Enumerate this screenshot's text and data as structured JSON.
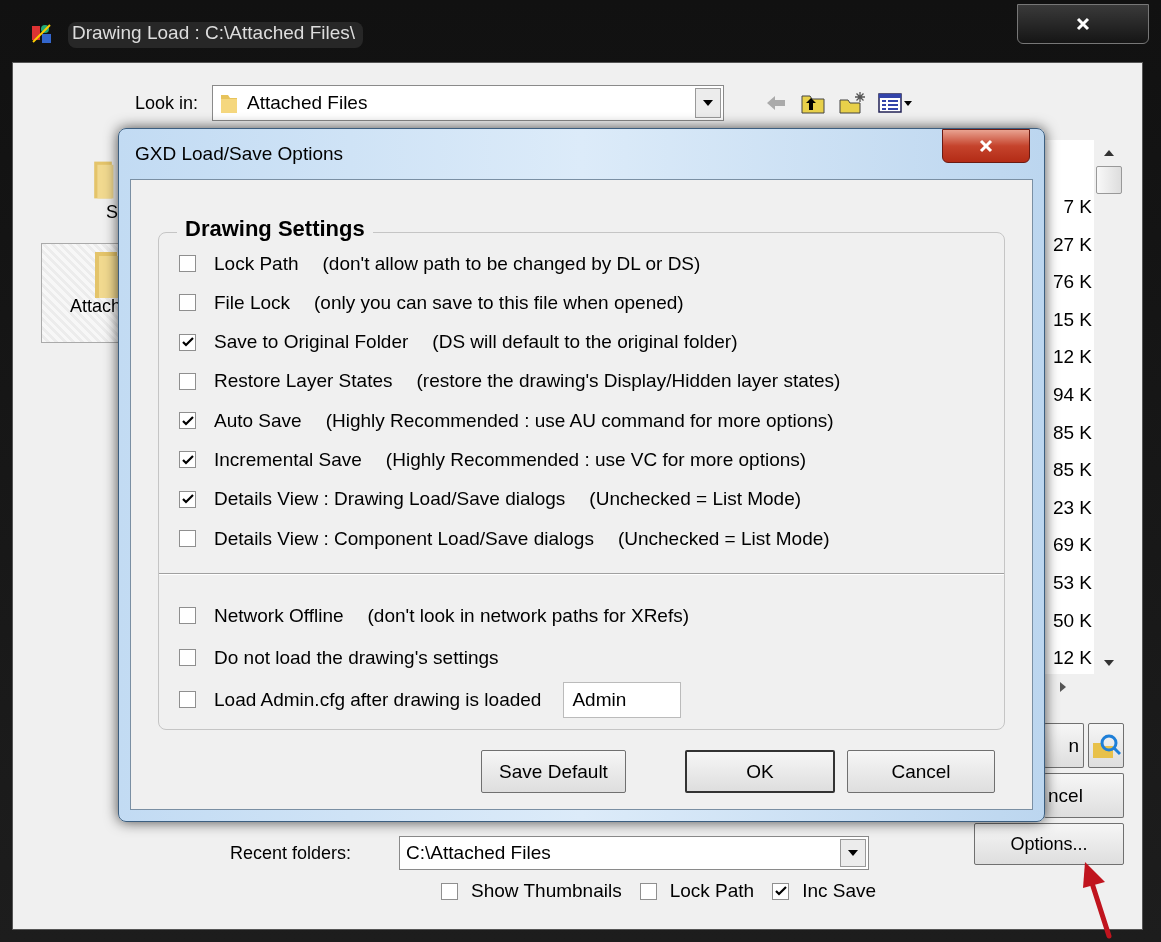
{
  "window": {
    "title": "Drawing Load : C:\\Attached Files\\"
  },
  "look_in": {
    "label": "Look in:",
    "value": "Attached Files"
  },
  "places": [
    {
      "label": "S",
      "selected": false
    },
    {
      "label": "Attach",
      "selected": true
    }
  ],
  "file_sizes": [
    "7 K",
    "27 K",
    "76 K",
    "15 K",
    "12 K",
    "94 K",
    "85 K",
    "85 K",
    "23 K",
    "69 K",
    "53 K",
    "50 K",
    "12 K"
  ],
  "side_buttons": [
    {
      "label": "n"
    },
    {
      "label": "ncel"
    },
    {
      "label": "Options..."
    }
  ],
  "recent_folders": {
    "label": "Recent folders:",
    "value": "C:\\Attached Files"
  },
  "bottom_options": [
    {
      "label": "Show Thumbnails",
      "checked": false
    },
    {
      "label": "Lock Path",
      "checked": false
    },
    {
      "label": "Inc Save",
      "checked": true
    }
  ],
  "dialog": {
    "title": "GXD Load/Save Options",
    "group": "Drawing Settings",
    "settings": [
      {
        "label": "Lock Path",
        "note": "(don't allow path to be changed by DL or DS)",
        "checked": false
      },
      {
        "label": "File Lock",
        "note": "(only you can save to this file when opened)",
        "checked": false
      },
      {
        "label": "Save to Original Folder",
        "note": "(DS will default to the original folder)",
        "checked": true
      },
      {
        "label": "Restore Layer States",
        "note": "(restore the drawing's Display/Hidden layer states)",
        "checked": false
      },
      {
        "label": "Auto Save",
        "note": "(Highly Recommended : use AU command for more options)",
        "checked": true
      },
      {
        "label": "Incremental Save",
        "note": "(Highly Recommended : use VC for more options)",
        "checked": true
      },
      {
        "label": "Details View : Drawing Load/Save dialogs",
        "note": "(Unchecked = List Mode)",
        "checked": true
      },
      {
        "label": "Details View : Component Load/Save dialogs",
        "note": "(Unchecked = List Mode)",
        "checked": false
      }
    ],
    "extra_settings": [
      {
        "label": "Network Offline",
        "note": "(don't look in network paths for XRefs)",
        "checked": false
      },
      {
        "label": "Do not load the drawing's settings",
        "checked": false
      },
      {
        "label": "Load Admin.cfg after drawing is loaded",
        "checked": false,
        "field": "Admin"
      }
    ],
    "buttons": [
      {
        "label": "Save Default",
        "default": false
      },
      {
        "label": "OK",
        "default": true
      },
      {
        "label": "Cancel",
        "default": false
      }
    ]
  }
}
